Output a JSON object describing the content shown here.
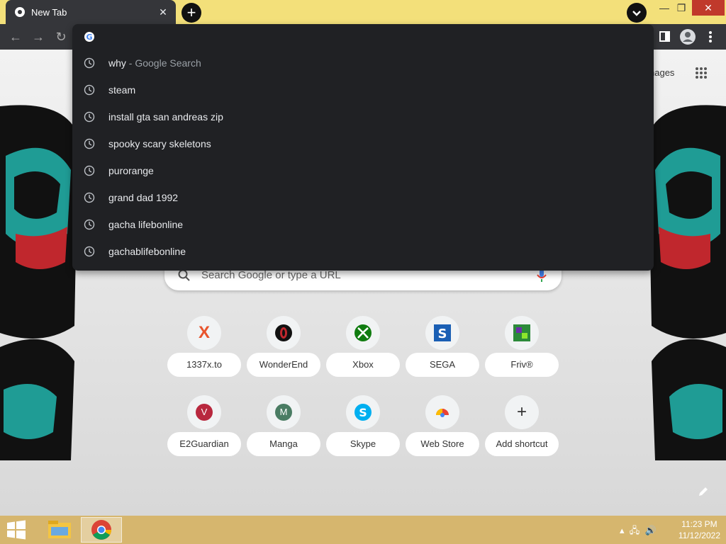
{
  "tab": {
    "title": "New Tab",
    "close": "✕",
    "favicon": "chrome-icon"
  },
  "toolbar": {
    "back": "back-icon",
    "forward": "forward-icon",
    "reload": "reload-icon",
    "sidepanel": "side-panel-icon",
    "profile": "profile-icon",
    "menu": "more-icon"
  },
  "window": {
    "minimize": "—",
    "restore": "❐",
    "close": "✕"
  },
  "omnibox": {
    "input_value": "",
    "suggestions": [
      {
        "text": "why",
        "suffix": " - Google Search"
      },
      {
        "text": "steam",
        "suffix": ""
      },
      {
        "text": "install gta san andreas zip",
        "suffix": ""
      },
      {
        "text": "spooky scary skeletons",
        "suffix": ""
      },
      {
        "text": "purorange",
        "suffix": ""
      },
      {
        "text": "grand dad 1992",
        "suffix": ""
      },
      {
        "text": "gacha lifebonline",
        "suffix": ""
      },
      {
        "text": "gachablifebonline",
        "suffix": ""
      }
    ]
  },
  "ntp": {
    "images_link": "nages",
    "search_placeholder": "Search Google or type a URL",
    "shortcuts": [
      {
        "label": "1337x.to",
        "icon": "x-icon"
      },
      {
        "label": "WonderEnd",
        "icon": "wonderend-icon"
      },
      {
        "label": "Xbox",
        "icon": "xbox-icon"
      },
      {
        "label": "SEGA",
        "icon": "sega-icon"
      },
      {
        "label": "Friv®",
        "icon": "friv-icon"
      },
      {
        "label": "E2Guardian",
        "icon": "e2guardian-icon",
        "letter": "V"
      },
      {
        "label": "Manga",
        "icon": "manga-icon",
        "letter": "M"
      },
      {
        "label": "Skype",
        "icon": "skype-icon"
      },
      {
        "label": "Web Store",
        "icon": "webstore-icon"
      },
      {
        "label": "Add shortcut",
        "icon": "plus-icon"
      }
    ]
  },
  "taskbar": {
    "time": "11:23 PM",
    "date": "11/12/2022"
  },
  "colors": {
    "tab_strip": "#f3e07a",
    "omnibox_bg": "#202124",
    "toolbar": "#35363a"
  }
}
